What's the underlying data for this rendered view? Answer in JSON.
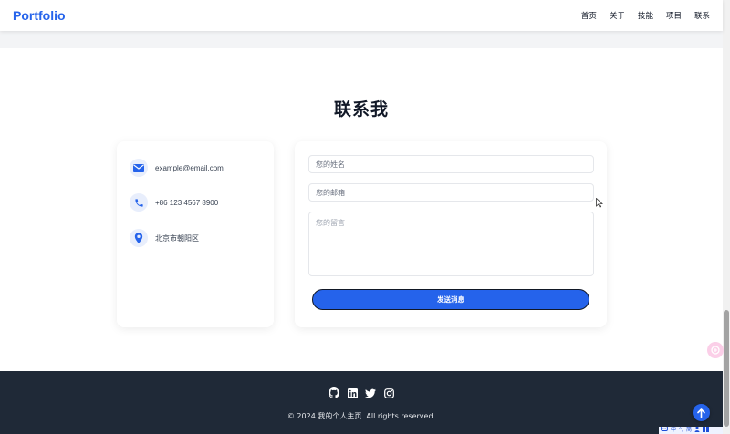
{
  "nav": {
    "logo": "Portfolio",
    "links": [
      "首页",
      "关于",
      "技能",
      "项目",
      "联系"
    ]
  },
  "contact": {
    "title": "联系我",
    "info": {
      "email": "example@email.com",
      "phone": "+86 123 4567 8900",
      "location": "北京市朝阳区"
    },
    "form": {
      "name_placeholder": "您的姓名",
      "email_placeholder": "您的邮箱",
      "message_placeholder": "您的留言",
      "submit_label": "发送消息"
    }
  },
  "footer": {
    "social_icons": [
      "github-icon",
      "linkedin-icon",
      "twitter-icon",
      "instagram-icon"
    ],
    "copyright": "© 2024 我的个人主页. All rights reserved."
  },
  "ime_toolbar": {
    "items": [
      "中",
      "°,",
      "简"
    ]
  },
  "colors": {
    "accent": "#2563eb",
    "footer_bg": "#1f2937",
    "section_band": "#f3f4f6"
  }
}
